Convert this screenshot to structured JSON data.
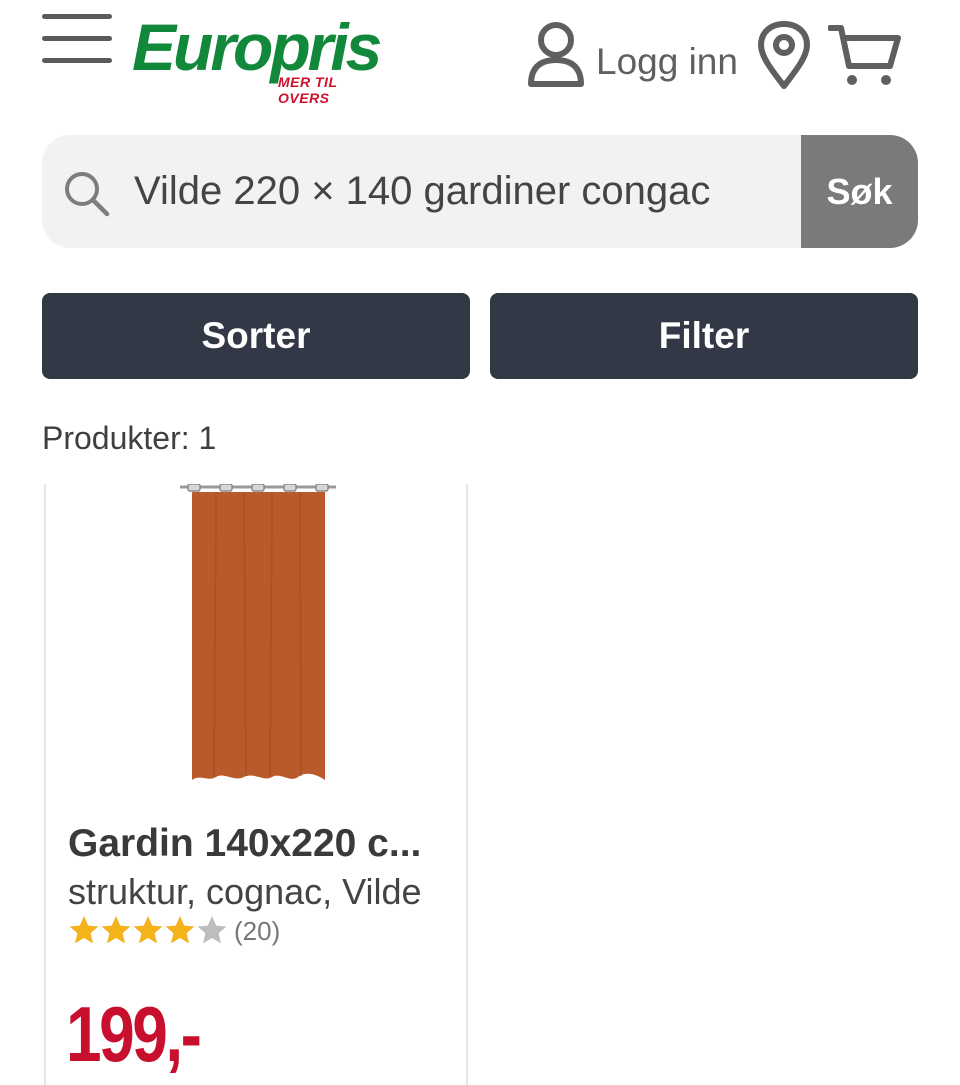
{
  "header": {
    "logo_text": "Europris",
    "logo_tagline": "MER TIL OVERS",
    "login_label": "Logg inn",
    "menu_icon": "hamburger-menu-icon",
    "location_icon": "map-pin-icon",
    "cart_icon": "shopping-cart-icon",
    "brand_green": "#11883a",
    "brand_red": "#d0112b"
  },
  "search": {
    "value": "Vilde 220 × 140 gardiner congac",
    "button_label": "Søk",
    "icon": "search-icon"
  },
  "toolbar": {
    "sort_label": "Sorter",
    "filter_label": "Filter",
    "button_color": "#333847"
  },
  "results": {
    "count_label": "Produkter: 1"
  },
  "products": [
    {
      "title": "Gardin 140x220 c...",
      "subtitle": "struktur, cognac, Vilde",
      "rating": 4.5,
      "review_count": "(20)",
      "price": "199,-",
      "image_color": "#b95a2b"
    }
  ]
}
